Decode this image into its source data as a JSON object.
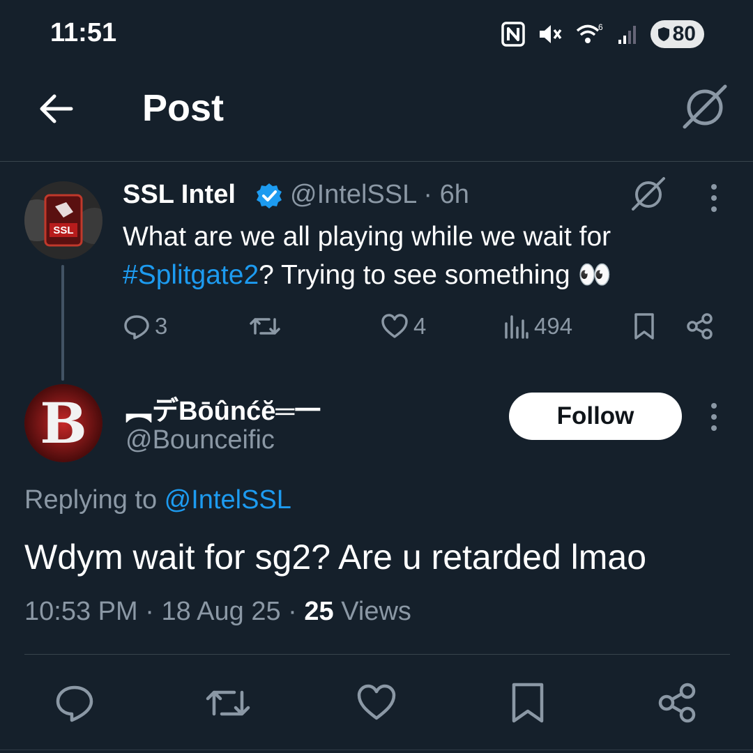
{
  "status_bar": {
    "time": "11:51",
    "battery": "80"
  },
  "header": {
    "title": "Post"
  },
  "parent_tweet": {
    "author_name": "SSL Intel",
    "handle": "@IntelSSL",
    "separator": "·",
    "time_ago": "6h",
    "text_before": "What are we all playing while we wait for ",
    "hashtag": "#Splitgate2",
    "text_after": "? Trying to see something 👀",
    "replies": "3",
    "likes": "4",
    "views": "494",
    "avatar_badge": "SSL"
  },
  "reply": {
    "author_name": "︻デBōûnćĕ═一",
    "handle": "@Bounceific",
    "follow_label": "Follow",
    "replying_prefix": "Replying to ",
    "replying_mention": "@IntelSSL",
    "text": "Wdym wait for sg2? Are u retarded lmao",
    "time": "10:53 PM",
    "dot1": "·",
    "date": "18 Aug 25",
    "dot2": "·",
    "views_count": "25",
    "views_label": " Views",
    "avatar_letter": "B"
  },
  "colors": {
    "background": "#15202b",
    "link": "#1d9bf0",
    "muted": "#8b98a5",
    "verified": "#1d9bf0"
  },
  "icons": [
    "arrow-left-icon",
    "grok-icon",
    "verified-badge-icon",
    "more-vertical-icon",
    "reply-icon",
    "retweet-icon",
    "like-icon",
    "views-icon",
    "bookmark-icon",
    "share-icon"
  ]
}
